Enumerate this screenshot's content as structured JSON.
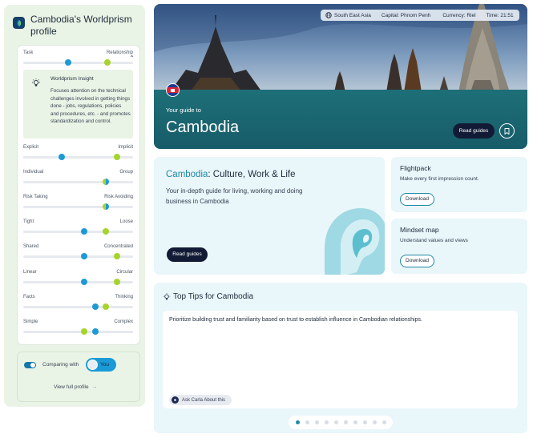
{
  "profile": {
    "title": "Cambodia's Worldprism profile",
    "insight": {
      "title": "Worldprism Insight",
      "text": "Focuses attention on the technical challenges involved in getting things done - jobs, regulations, policies and procedures, etc. - and promotes standardization and control."
    },
    "dimensions": [
      {
        "left": "Task",
        "right": "Relationship"
      },
      {
        "left": "Explicit",
        "right": "Implicit"
      },
      {
        "left": "Individual",
        "right": "Group"
      },
      {
        "left": "Risk Taking",
        "right": "Risk Avoiding"
      },
      {
        "left": "Tight",
        "right": "Loose"
      },
      {
        "left": "Shared",
        "right": "Concentrated"
      },
      {
        "left": "Linear",
        "right": "Circular"
      },
      {
        "left": "Facts",
        "right": "Thinking"
      },
      {
        "left": "Simple",
        "right": "Complex"
      }
    ],
    "comparing_label": "Comparing with",
    "comparing_with": "You",
    "comparing_enabled": true,
    "view_full": "View full profile",
    "colors": {
      "country_marker": "#1d9ad6",
      "you_marker": "#a6d42a"
    }
  },
  "hero": {
    "region": "South East Asia",
    "capital_label": "Capital:",
    "capital": "Phnom Penh",
    "currency_label": "Currency:",
    "currency": "Riel",
    "time_label": "Time:",
    "time": "21:51",
    "guide_label": "Your guide to",
    "country": "Cambodia",
    "read_label": "Read guides"
  },
  "culture": {
    "title_country": "Cambodia",
    "title_rest": ": Culture, Work & Life",
    "subtitle": "Your in-depth guide for living, working and doing business in Cambodia",
    "read_label": "Read guides"
  },
  "flightpack": {
    "title": "Flightpack",
    "subtitle": "Make every first impression count.",
    "button": "Download"
  },
  "mindset": {
    "title": "Mindset map",
    "subtitle": "Understand values and views",
    "button": "Download"
  },
  "tips": {
    "title": "Top Tips for Cambodia",
    "text": "Prioritize building trust and familiarity based on trust to establish influence in Cambodian relationships.",
    "ask_label": "Ask Carla About this",
    "page_count": 10,
    "current_page": 1
  }
}
